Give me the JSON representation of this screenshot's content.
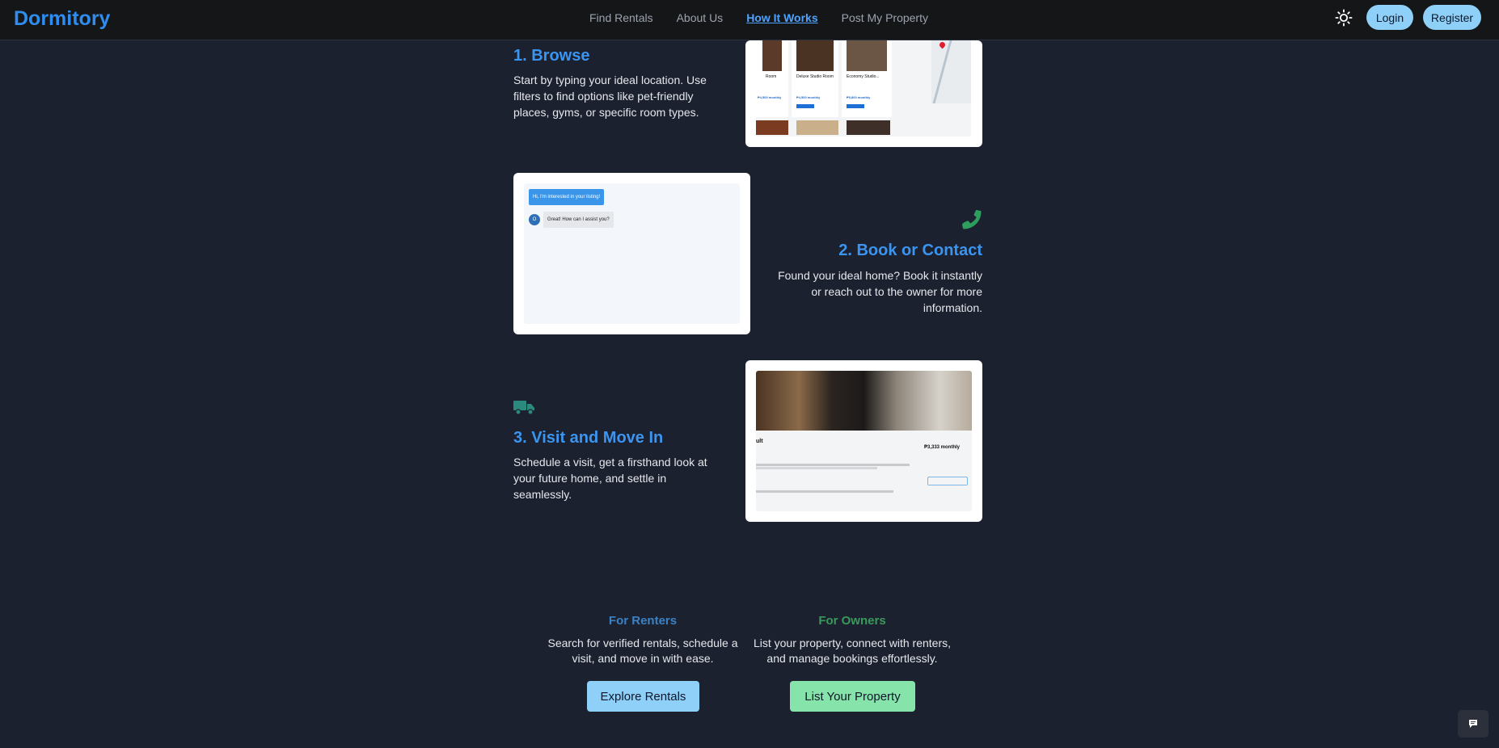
{
  "brand": "Dormitory",
  "nav": {
    "links": [
      "Find Rentals",
      "About Us",
      "How It Works",
      "Post My Property"
    ],
    "active": "How It Works",
    "login": "Login",
    "register": "Register"
  },
  "steps": [
    {
      "title": "1. Browse",
      "description": "Start by typing your ideal location. Use filters to find options like pet-friendly places, gyms, or specific room types.",
      "preview": {
        "listing_titles": [
          "Room",
          "Deluxe Studio Room",
          "Economy Studio..."
        ],
        "prices": [
          "₱4,500 monthly",
          "₱4,500 monthly",
          "₱5,800 monthly"
        ]
      }
    },
    {
      "title": "2. Book or Contact",
      "description": "Found your ideal home? Book it instantly or reach out to the owner for more information.",
      "icon": "phone-icon",
      "chat": {
        "outgoing": "Hi, I'm interested in your listing!",
        "incoming": "Great! How can I assist you?",
        "avatar_letter": "O"
      }
    },
    {
      "title": "3. Visit and Move In",
      "description": "Schedule a visit, get a firsthand look at your future home, and settle in seamlessly.",
      "icon": "truck-icon",
      "preview": {
        "price": "₱3,333 monthly",
        "title_fragment": "ult"
      }
    }
  ],
  "audiences": {
    "renters": {
      "title": "For Renters",
      "description": "Search for verified rentals, schedule a visit, and move in with ease.",
      "cta": "Explore Rentals",
      "color": "#3b82c4"
    },
    "owners": {
      "title": "For Owners",
      "description": "List your property, connect with renters, and manage bookings effortlessly.",
      "cta": "List Your Property",
      "color": "#3a9a5b"
    }
  },
  "colors": {
    "background": "#1c2130",
    "accent_blue": "#3b95f0",
    "accent_green": "#2e9e5e",
    "pill_blue": "#8fd0f8",
    "cta_green": "#86e3a9"
  }
}
